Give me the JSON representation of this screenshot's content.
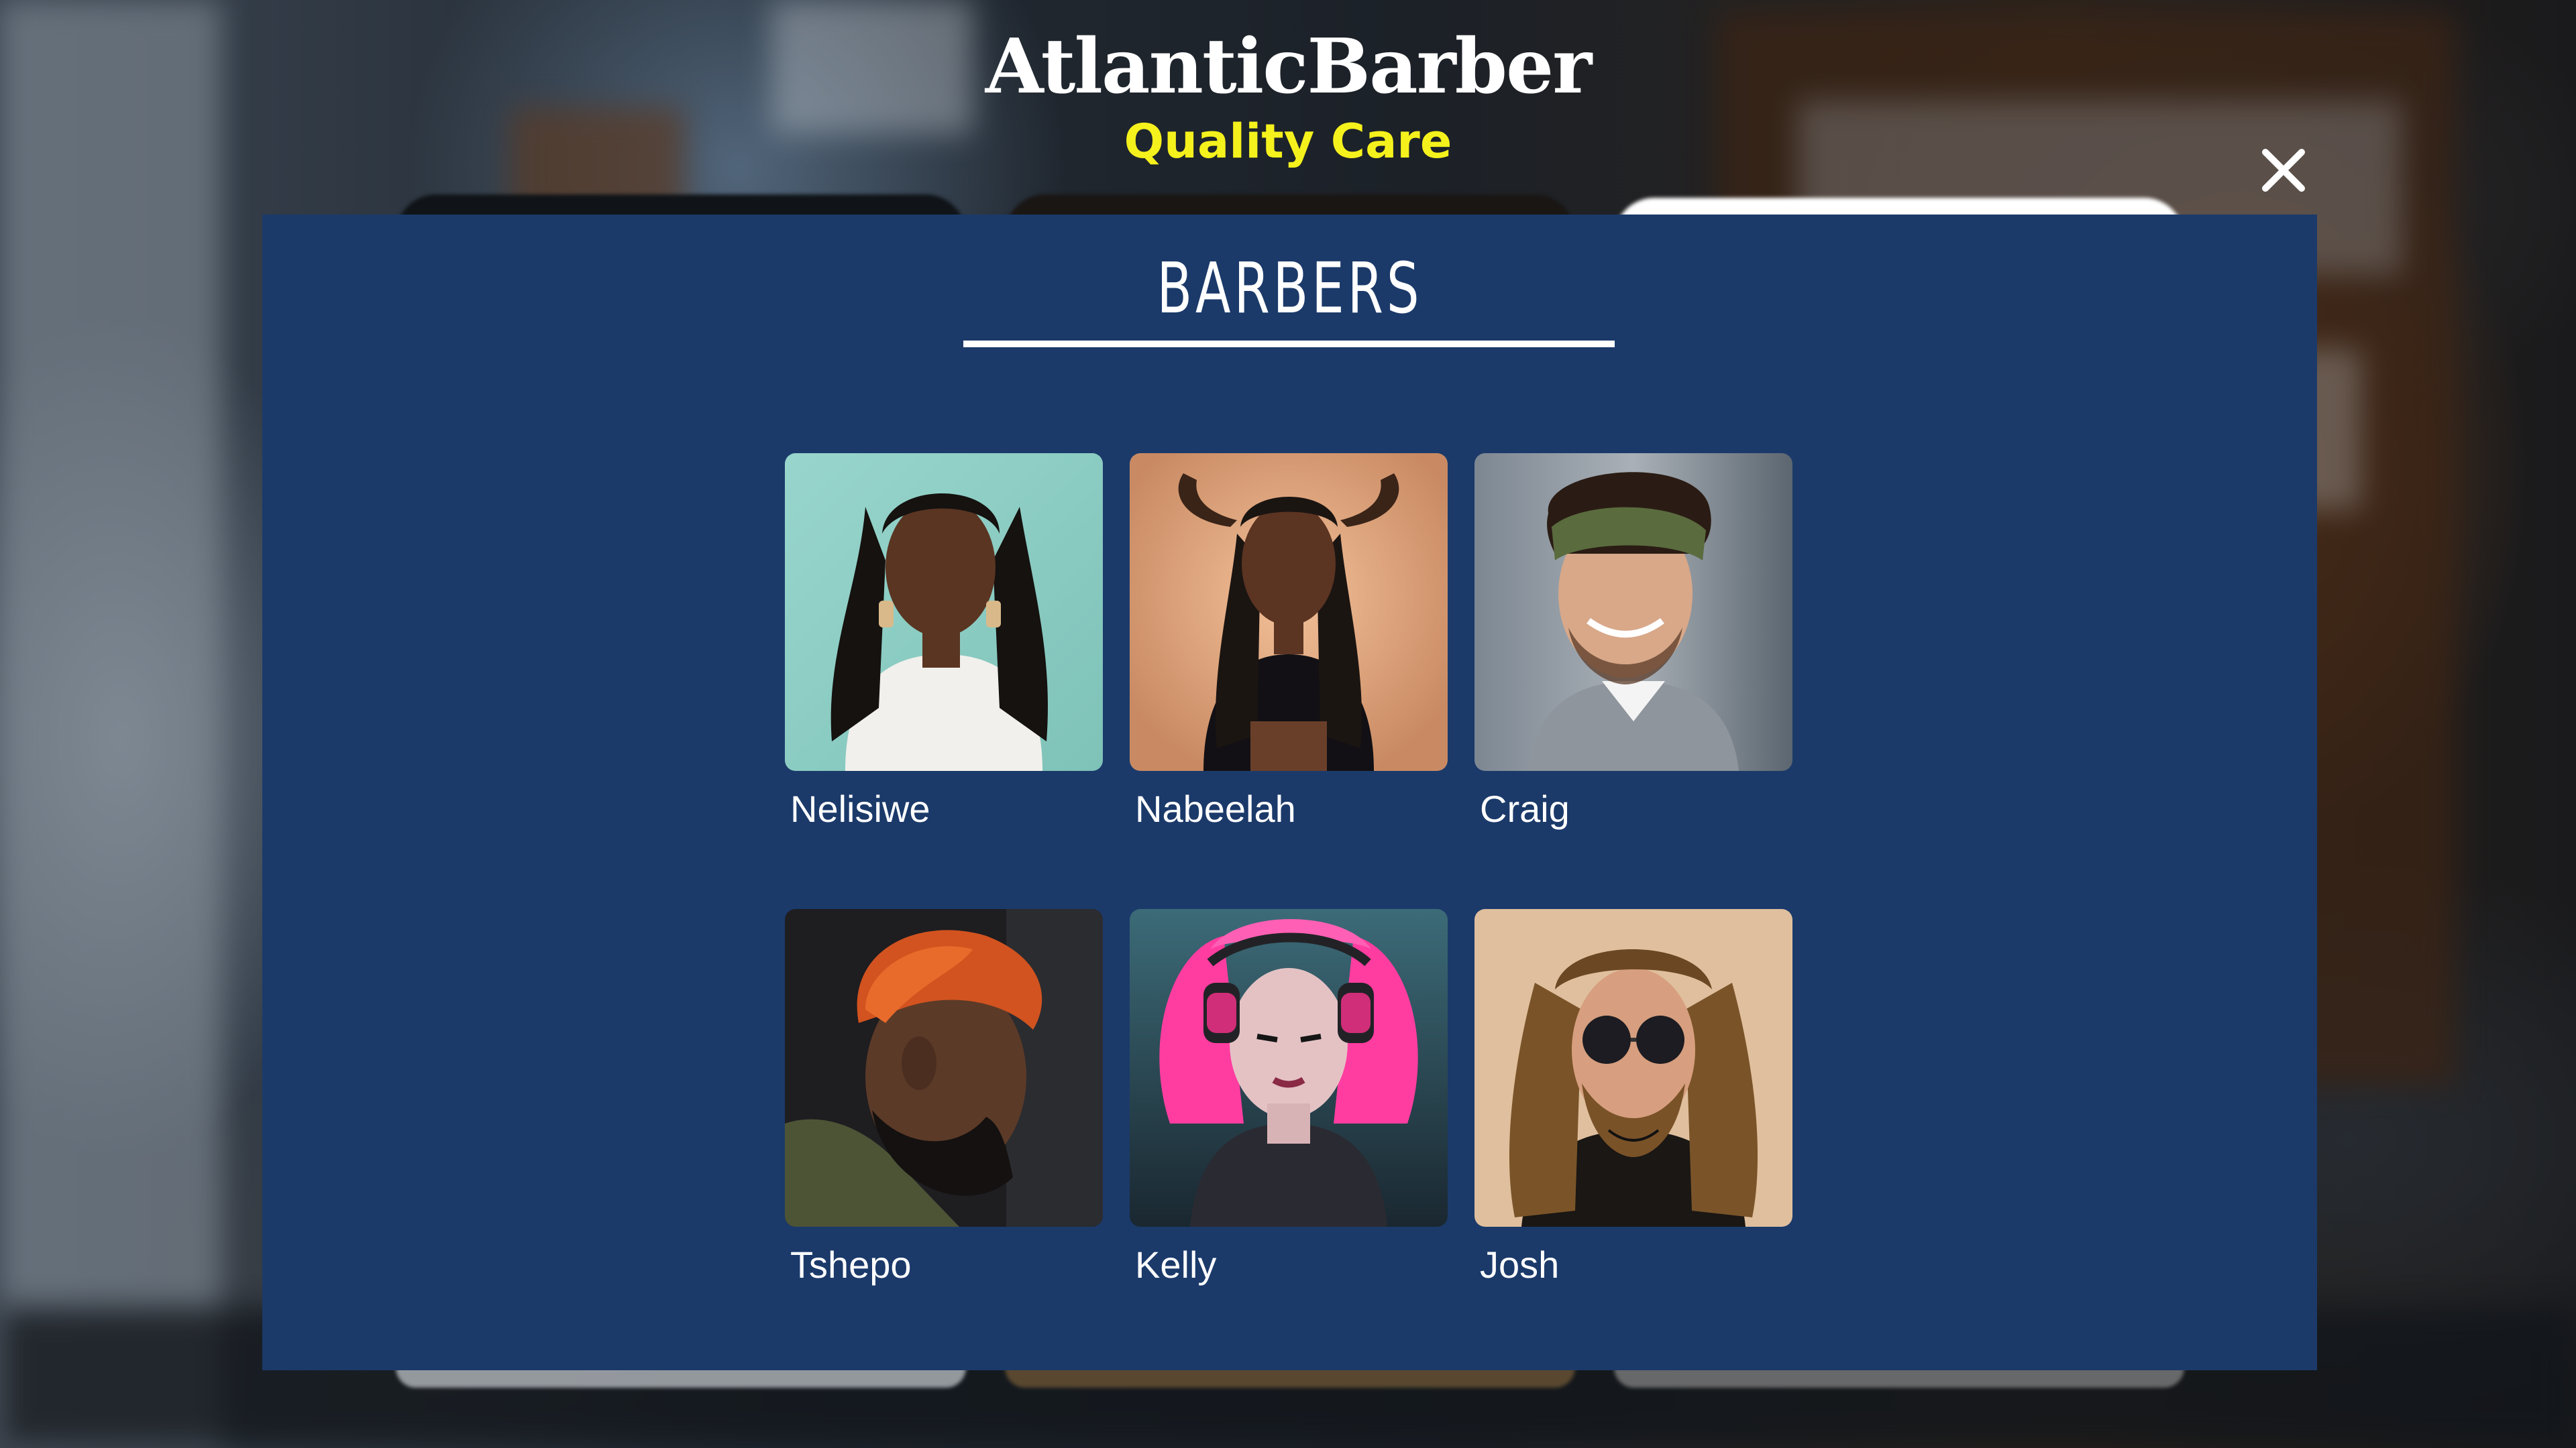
{
  "brand": {
    "title": "AtlanticBarber",
    "subtitle": "Quality Care"
  },
  "modal": {
    "title": "BARBERS",
    "close_icon": "close-icon",
    "colors": {
      "panel": "#1b3a6a",
      "accent_yellow": "#f5f11c",
      "text": "#ffffff"
    }
  },
  "barbers": [
    {
      "name": "Nelisiwe"
    },
    {
      "name": "Nabeelah"
    },
    {
      "name": "Craig"
    },
    {
      "name": "Tshepo"
    },
    {
      "name": "Kelly"
    },
    {
      "name": "Josh"
    }
  ]
}
